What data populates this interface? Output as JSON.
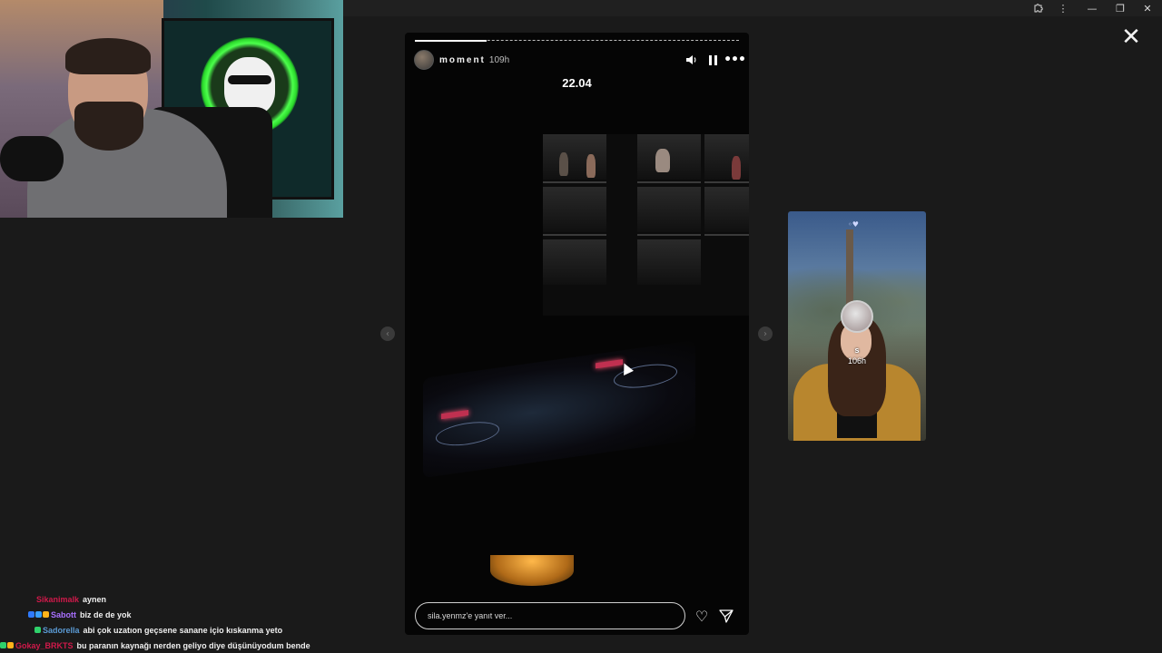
{
  "window": {
    "controls": {
      "extensions_icon": "puzzle-icon",
      "menu_icon": "⋮",
      "minimize": "—",
      "restore": "❐",
      "close": "✕"
    }
  },
  "story_viewer": {
    "close_icon": "✕",
    "prev_arrow": "‹",
    "next_arrow": "›",
    "current": {
      "username": "moment",
      "time_ago": "109h",
      "caption": "22.04",
      "progress": 0.22,
      "icons": {
        "mute": "🔈",
        "more": "•••"
      },
      "reply_placeholder": "sila.yenmz'e yanıt ver...",
      "like_icon": "♡",
      "share_icon": "➢"
    },
    "next_preview": {
      "username": "s",
      "time_ago": "106h"
    }
  },
  "chat": {
    "messages": [
      {
        "user": "Sikanimalk",
        "color": "#d0194a",
        "text": "aynen",
        "badges": []
      },
      {
        "user": "Sabott",
        "color": "#a970ff",
        "text": "biz de de yok",
        "badges": [
          "#2f7bff",
          "#3aa0ff",
          "#ffb31a"
        ]
      },
      {
        "user": "Sadorella",
        "color": "#5b9bd5",
        "text": "abi çok uzatıon geçsene sanane içio kıskanma yeto",
        "badges": [
          "#2fd16b"
        ]
      },
      {
        "user": "Gokay_BRKTS",
        "color": "#d0194a",
        "text": "bu paranın kaynağı nerden geliyo diye düşünüyodum bende",
        "badges": [
          "#2fd16b",
          "#ffb31a"
        ]
      }
    ]
  }
}
